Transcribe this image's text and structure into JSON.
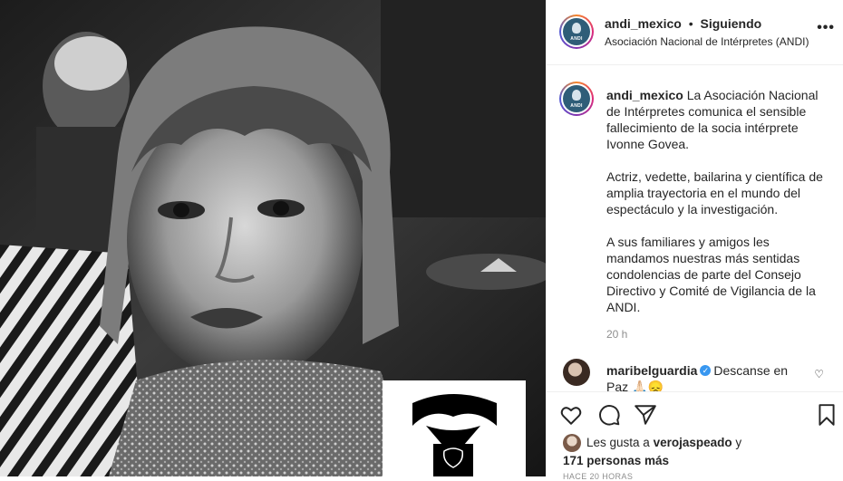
{
  "photo": {
    "description_icon": "ribbon-logo-icon"
  },
  "header": {
    "username": "andi_mexico",
    "separator": "•",
    "follow_status": "Siguiendo",
    "location": "Asociación Nacional de Intérpretes (ANDI)",
    "more_icon": "•••",
    "avatar_text": "ANDI"
  },
  "caption": {
    "username": "andi_mexico",
    "paragraph_1": "La Asociación Nacional de Intérpretes comunica el sensible fallecimiento de la socia intérprete Ivonne Govea.",
    "paragraph_2": "Actriz, vedette, bailarina y científica de amplia trayectoria en el mundo del espectáculo y la investigación.",
    "paragraph_3": "A sus familiares y amigos les mandamos nuestras más sentidas condolencias de parte del Consejo Directivo y Comité de Vigilancia de la ANDI.",
    "time_ago": "20 h"
  },
  "comment": {
    "username": "maribelguardia",
    "verified_glyph": "✓",
    "text": "Descanse en Paz 🙏🏻😞",
    "like_icon": "♡"
  },
  "actions": {
    "likes_prefix": "Les gusta a",
    "likes_user": "verojaspeado",
    "likes_and": "y",
    "likes_count": "171 personas más",
    "date": "HACE 20 HORAS"
  },
  "colors": {
    "accent_verified": "#3897f0",
    "text": "#262626",
    "muted": "#8e8e8e"
  }
}
